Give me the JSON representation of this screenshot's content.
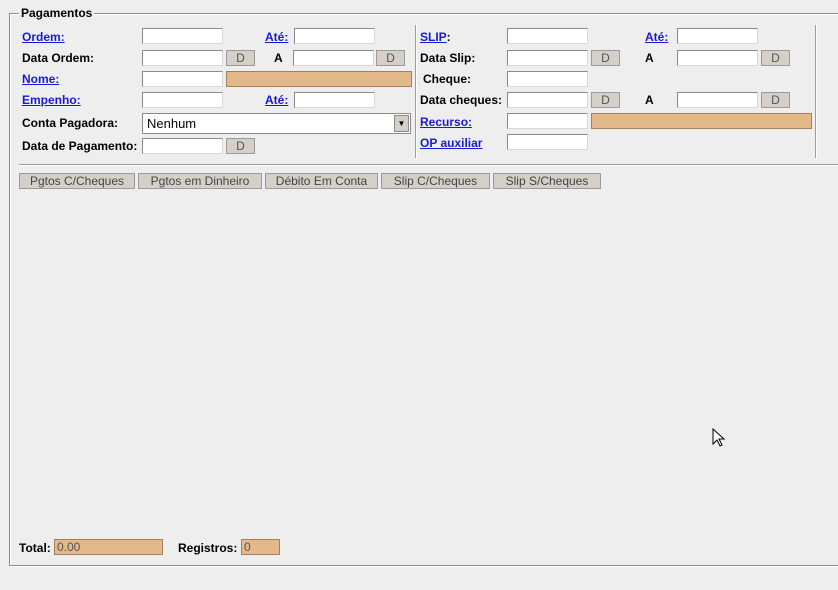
{
  "legend": "Pagamentos",
  "left": {
    "ordem_label": "Ordem:",
    "ordem_ate_label": "Até:",
    "data_ordem_label": "Data Ordem:",
    "data_ordem_a_label": "A",
    "nome_label": "Nome:",
    "empenho_label": "Empenho:",
    "empenho_ate_label": "Até:",
    "conta_label": "Conta Pagadora:",
    "conta_selected": "Nenhum",
    "data_pagamento_label": "Data de Pagamento:"
  },
  "right": {
    "slip_label": "SLIP",
    "slip_colon": ":",
    "slip_ate_label": "Até:",
    "data_slip_label": "Data Slip:",
    "data_slip_a_label": "A",
    "cheque_label": "Cheque:",
    "data_cheques_label": "Data cheques:",
    "data_cheques_a_label": "A",
    "recurso_label": "Recurso:",
    "op_auxiliar_label": "OP auxiliar"
  },
  "date_button_label": "D",
  "tabs": [
    "Pgtos C/Cheques",
    "Pgtos em Dinheiro",
    "Débito Em Conta",
    "Slip C/Cheques",
    "Slip S/Cheques"
  ],
  "footer": {
    "total_label": "Total:",
    "total_value": "0.00",
    "registros_label": "Registros:",
    "registros_value": "0"
  },
  "colors": {
    "background": "#eeeeee",
    "link": "#1a1ad6",
    "readonly_field": "#e3b98a"
  }
}
